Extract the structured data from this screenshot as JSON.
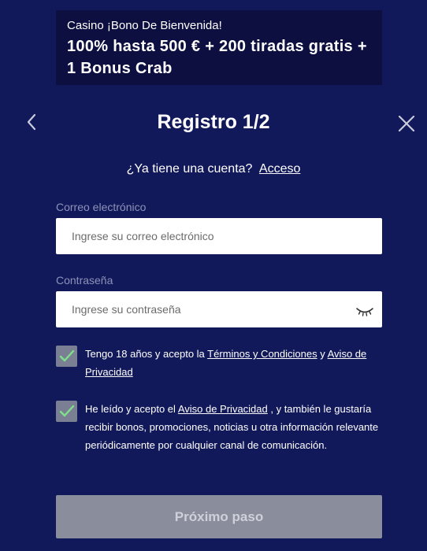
{
  "banner": {
    "subtitle": "Casino ¡Bono De Bienvenida!",
    "title": "100% hasta 500 € + 200 tiradas gratis + 1 Bonus Crab"
  },
  "header": {
    "title": "Registro 1/2",
    "back_icon": "chevron-left-icon",
    "close_icon": "close-icon"
  },
  "login": {
    "prompt": "¿Ya tiene una cuenta?",
    "link": "Acceso"
  },
  "form": {
    "email": {
      "label": "Correo electrónico",
      "placeholder": "Ingrese su correo electrónico",
      "value": ""
    },
    "password": {
      "label": "Contraseña",
      "placeholder": "Ingrese su contraseña",
      "value": "",
      "toggle_icon": "eye-closed-icon"
    }
  },
  "consents": {
    "terms": {
      "checked": true,
      "text_before": "Tengo 18 años y acepto la ",
      "link1": "Términos y Condiciones",
      "text_middle": " y ",
      "link2": "Aviso de Privacidad"
    },
    "marketing": {
      "checked": true,
      "text_before": "He leído y acepto el ",
      "link": "Aviso de Privacidad",
      "text_after": " , y también le gustaría recibir bonos, promociones, noticias u otra información relevante periódicamente por cualquier canal de comunicación."
    }
  },
  "actions": {
    "next_label": "Próximo paso"
  },
  "colors": {
    "background": "#12195a",
    "banner_background": "#0c0f3f",
    "checkmark": "#7ee08a",
    "checkbox_fill": "#7a7f94",
    "button_disabled": "#8a8d9c"
  }
}
